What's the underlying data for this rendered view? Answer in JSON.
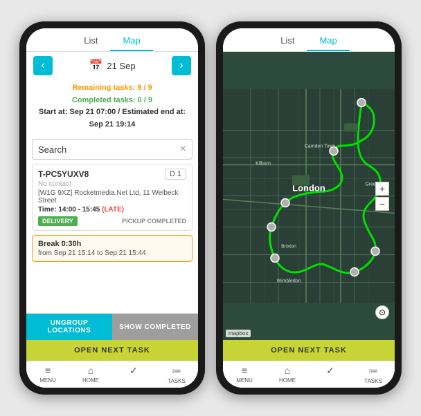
{
  "phone1": {
    "tabs": [
      {
        "label": "List",
        "active": false
      },
      {
        "label": "Map",
        "active": false
      }
    ],
    "activeTab": "List",
    "date": "21 Sep",
    "prevBtn": "‹",
    "nextBtn": "›",
    "remainingTasks": "Remaining tasks: 9 / 9",
    "completedTasks": "Completed tasks: 0 / 9",
    "startTime": "Start at: Sep 21 07:00 / Estimated end at: Sep 21 19:14",
    "searchPlaceholder": "Search",
    "clearIcon": "×",
    "task": {
      "id": "T-PC5YUXV8",
      "badge": "D 1",
      "contact": "No contact",
      "address": "[W1G 9XZ] Rocketmedia.Net Ltd, 11 Welbeck Street",
      "timeLabel": "Time:",
      "timeValue": "14:00 - 15:45",
      "lateLabel": "(LATE)",
      "deliveryTag": "DELIVERY",
      "pickupTag": "PICKUP COMPLETED"
    },
    "break": {
      "title": "Break 0:30h",
      "timeRange": "from Sep 21 15:14 to Sep 21 15:44"
    },
    "ungroupBtn": "UNGROUP LOCATIONS",
    "showCompletedBtn": "SHOW COMPLETED",
    "openNextBtn": "OPEN NEXT TASK",
    "nav": [
      {
        "icon": "≡",
        "label": "MENU"
      },
      {
        "icon": "⌂",
        "label": "HOME"
      },
      {
        "icon": "✓",
        "label": ""
      },
      {
        "icon": "≔",
        "label": "TASKS"
      }
    ]
  },
  "phone2": {
    "tabs": [
      {
        "label": "List",
        "active": false
      },
      {
        "label": "Map",
        "active": true
      }
    ],
    "activeTab": "Map",
    "openNextBtn": "OPEN NEXT TASK",
    "nav": [
      {
        "icon": "≡",
        "label": "MENU"
      },
      {
        "icon": "⌂",
        "label": "HOME"
      },
      {
        "icon": "✓",
        "label": ""
      },
      {
        "icon": "≔",
        "label": "TASKS"
      }
    ],
    "mapCredit": "mapbox",
    "zoomIn": "+",
    "zoomOut": "−",
    "cityLabel": "London",
    "subLabels": [
      "Kilburn",
      "Camden Town",
      "Brixton",
      "Wimbledon",
      "Greenford"
    ]
  }
}
